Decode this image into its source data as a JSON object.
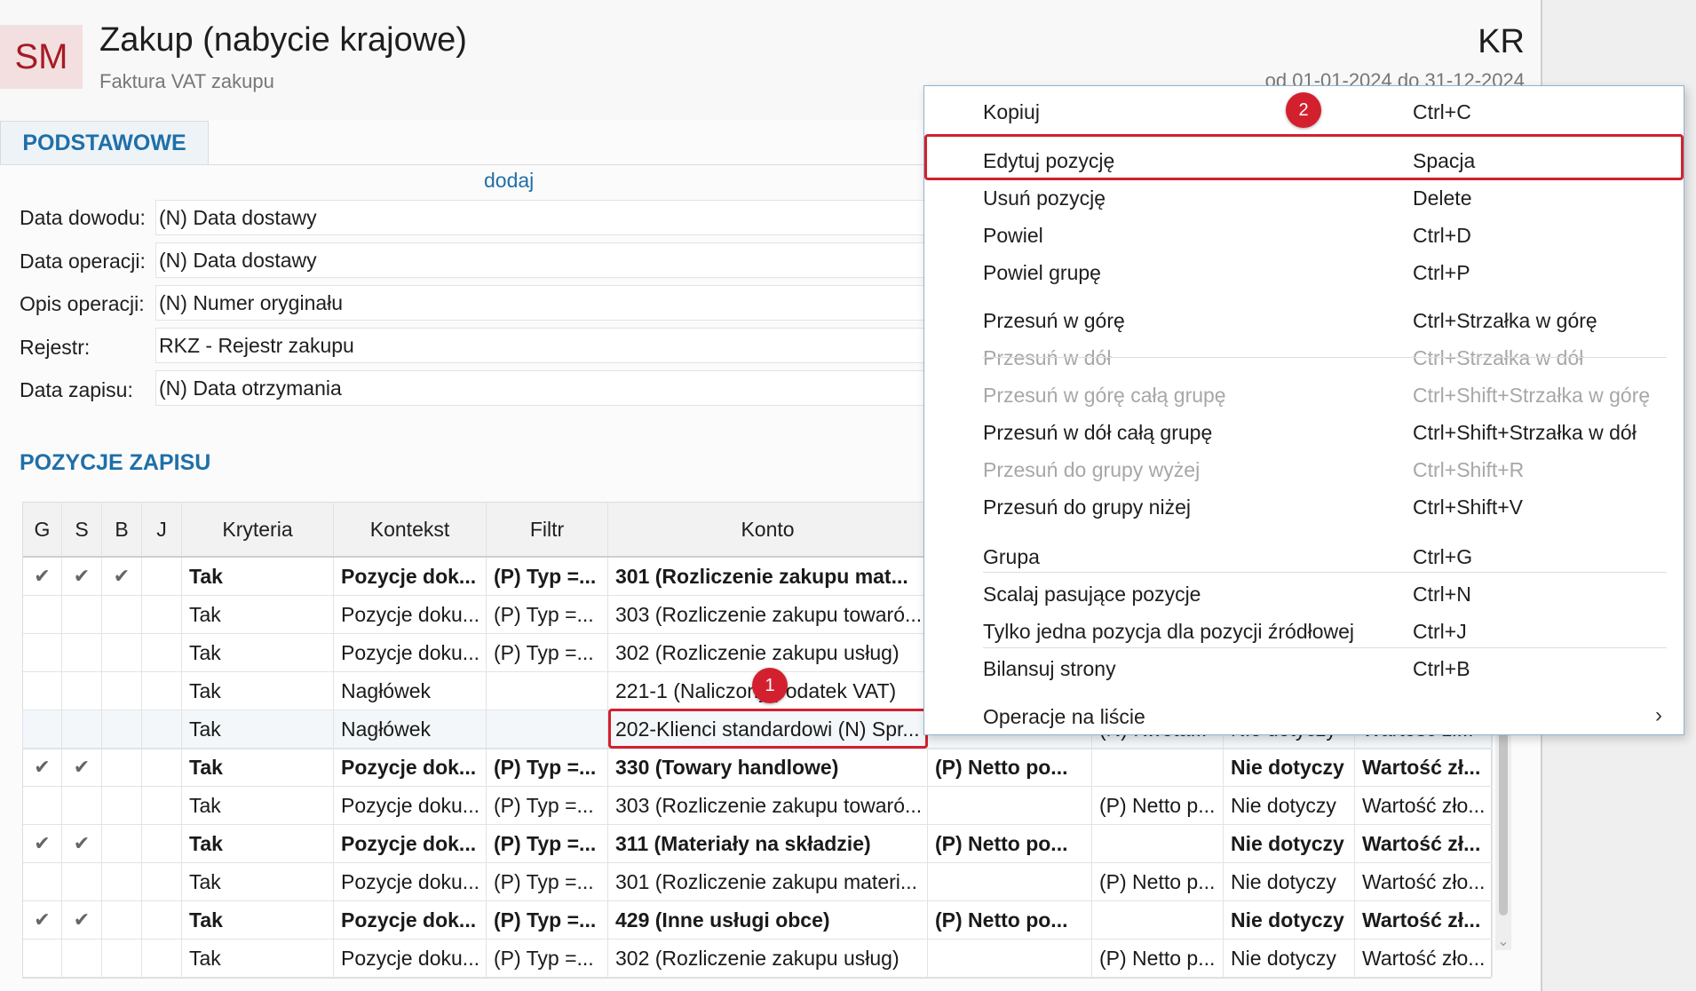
{
  "header": {
    "badge": "SM",
    "title": "Zakup (nabycie krajowe)",
    "subtitle": "Faktura VAT zakupu",
    "code": "KR",
    "period": "od 01-01-2024 do 31-12-2024"
  },
  "tabs": {
    "active": "PODSTAWOWE"
  },
  "add_link": "dodaj",
  "form": [
    {
      "label": "Data dowodu:",
      "value": "(N) Data dostawy"
    },
    {
      "label": "Data operacji:",
      "value": "(N) Data dostawy"
    },
    {
      "label": "Opis operacji:",
      "value": "(N) Numer oryginału"
    },
    {
      "label": "Rejestr:",
      "value": "RKZ - Rejestr zakupu"
    },
    {
      "label": "Data zapisu:",
      "value": "(N) Data otrzymania"
    }
  ],
  "section_title": "POZYCJE ZAPISU",
  "grid": {
    "headers": [
      "G",
      "S",
      "B",
      "J",
      "Kryteria",
      "Kontekst",
      "Filtr",
      "Konto",
      "",
      "",
      "",
      ""
    ],
    "rows": [
      {
        "g": "✔",
        "s": "✔",
        "b": "✔",
        "j": "",
        "kryteria": "Tak",
        "kontekst": "Pozycje dok...",
        "filtr": "(P) Typ =...",
        "konto": "301 (Rozliczenie zakupu mat...",
        "c9": "",
        "c10": "",
        "c11": "",
        "c12": "",
        "bold": true
      },
      {
        "g": "",
        "s": "",
        "b": "",
        "j": "",
        "kryteria": "Tak",
        "kontekst": "Pozycje doku...",
        "filtr": "(P) Typ =...",
        "konto": "303 (Rozliczenie zakupu towaró...",
        "c9": "",
        "c10": "",
        "c11": "",
        "c12": "",
        "bold": false
      },
      {
        "g": "",
        "s": "",
        "b": "",
        "j": "",
        "kryteria": "Tak",
        "kontekst": "Pozycje doku...",
        "filtr": "(P) Typ =...",
        "konto": "302 (Rozliczenie zakupu usług)",
        "c9": "",
        "c10": "",
        "c11": "",
        "c12": "",
        "bold": false
      },
      {
        "g": "",
        "s": "",
        "b": "",
        "j": "",
        "kryteria": "Tak",
        "kontekst": "Nagłówek",
        "filtr": "",
        "konto": "221-1 (Naliczony podatek VAT)",
        "c9": "",
        "c10": "",
        "c11": "",
        "c12": "",
        "bold": false
      },
      {
        "g": "",
        "s": "",
        "b": "",
        "j": "",
        "kryteria": "Tak",
        "kontekst": "Nagłówek",
        "filtr": "",
        "konto": "202-Klienci standardowi (N) Spr...",
        "c9": "",
        "c10": "(N) Kwota...",
        "c11": "Nie dotyczy",
        "c12": "Wartość zł...",
        "bold": false,
        "selected": true
      },
      {
        "g": "✔",
        "s": "✔",
        "b": "",
        "j": "",
        "kryteria": "Tak",
        "kontekst": "Pozycje dok...",
        "filtr": "(P) Typ =...",
        "konto": "330 (Towary handlowe)",
        "c9": "(P) Netto po...",
        "c10": "",
        "c11": "Nie dotyczy",
        "c12": "Wartość zł...",
        "bold": true
      },
      {
        "g": "",
        "s": "",
        "b": "",
        "j": "",
        "kryteria": "Tak",
        "kontekst": "Pozycje doku...",
        "filtr": "(P) Typ =...",
        "konto": "303 (Rozliczenie zakupu towaró...",
        "c9": "",
        "c10": "(P) Netto p...",
        "c11": "Nie dotyczy",
        "c12": "Wartość zło...",
        "bold": false
      },
      {
        "g": "✔",
        "s": "✔",
        "b": "",
        "j": "",
        "kryteria": "Tak",
        "kontekst": "Pozycje dok...",
        "filtr": "(P) Typ =...",
        "konto": "311 (Materiały na składzie)",
        "c9": "(P) Netto po...",
        "c10": "",
        "c11": "Nie dotyczy",
        "c12": "Wartość zł...",
        "bold": true
      },
      {
        "g": "",
        "s": "",
        "b": "",
        "j": "",
        "kryteria": "Tak",
        "kontekst": "Pozycje doku...",
        "filtr": "(P) Typ =...",
        "konto": "301 (Rozliczenie zakupu materi...",
        "c9": "",
        "c10": "(P) Netto p...",
        "c11": "Nie dotyczy",
        "c12": "Wartość zło...",
        "bold": false
      },
      {
        "g": "✔",
        "s": "✔",
        "b": "",
        "j": "",
        "kryteria": "Tak",
        "kontekst": "Pozycje dok...",
        "filtr": "(P) Typ =...",
        "konto": "429 (Inne usługi obce)",
        "c9": "(P) Netto po...",
        "c10": "",
        "c11": "Nie dotyczy",
        "c12": "Wartość zł...",
        "bold": true
      },
      {
        "g": "",
        "s": "",
        "b": "",
        "j": "",
        "kryteria": "Tak",
        "kontekst": "Pozycje doku...",
        "filtr": "(P) Typ =...",
        "konto": "302 (Rozliczenie zakupu usług)",
        "c9": "",
        "c10": "(P) Netto p...",
        "c11": "Nie dotyczy",
        "c12": "Wartość zło...",
        "bold": false
      }
    ]
  },
  "markers": {
    "one": "1",
    "two": "2"
  },
  "context_menu": {
    "items": [
      {
        "label": "Kopiuj",
        "shortcut": "Ctrl+C",
        "disabled": false
      },
      {
        "label": "Edytuj pozycję",
        "shortcut": "Spacja",
        "disabled": false,
        "highlighted": true
      },
      {
        "label": "Usuń pozycję",
        "shortcut": "Delete",
        "disabled": false
      },
      {
        "label": "Powiel",
        "shortcut": "Ctrl+D",
        "disabled": false
      },
      {
        "label": "Powiel grupę",
        "shortcut": "Ctrl+P",
        "disabled": false
      },
      {
        "label": "Przesuń w górę",
        "shortcut": "Ctrl+Strzałka w górę",
        "disabled": false
      },
      {
        "label": "Przesuń w dół",
        "shortcut": "Ctrl+Strzałka w dół",
        "disabled": true
      },
      {
        "label": "Przesuń w górę całą grupę",
        "shortcut": "Ctrl+Shift+Strzałka w górę",
        "disabled": true
      },
      {
        "label": "Przesuń w dół całą grupę",
        "shortcut": "Ctrl+Shift+Strzałka w dół",
        "disabled": false
      },
      {
        "label": "Przesuń do grupy wyżej",
        "shortcut": "Ctrl+Shift+R",
        "disabled": true
      },
      {
        "label": "Przesuń do grupy niżej",
        "shortcut": "Ctrl+Shift+V",
        "disabled": false
      },
      {
        "label": "Grupa",
        "shortcut": "Ctrl+G",
        "disabled": false
      },
      {
        "label": "Scalaj pasujące pozycje",
        "shortcut": "Ctrl+N",
        "disabled": false
      },
      {
        "label": "Tylko jedna pozycja dla pozycji źródłowej",
        "shortcut": "Ctrl+J",
        "disabled": false
      },
      {
        "label": "Bilansuj strony",
        "shortcut": "Ctrl+B",
        "disabled": false
      },
      {
        "label": "Operacje na liście",
        "shortcut": "",
        "disabled": false,
        "submenu": true
      }
    ]
  },
  "icons": {
    "check": "check-icon",
    "submenu": "chevron-right-icon",
    "scroll_down": "chevron-down-icon"
  },
  "colors": {
    "accent": "#1f6fa8",
    "highlight": "#d3202f",
    "badge_bg": "#f3dfdf",
    "badge_fg": "#a51c24",
    "disabled": "#a7a7a7"
  }
}
